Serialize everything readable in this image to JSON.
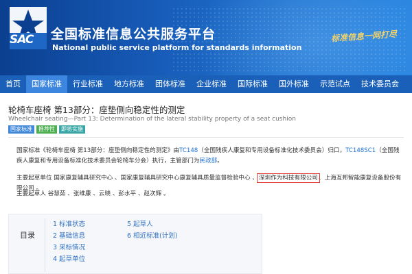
{
  "header": {
    "logo_text": "SAC",
    "title": "全国标准信息公共服务平台",
    "subtitle": "National public service platform  for standards information",
    "slogan": "标准信息一网打尽",
    "colors": {
      "banner": "#1659b5",
      "nav": "#1a5fb8",
      "nav_active": "#3c86e0",
      "slogan": "#f3d36b"
    }
  },
  "nav": {
    "items": [
      "首页",
      "国家标准",
      "行业标准",
      "地方标准",
      "团体标准",
      "企业标准",
      "国际标准",
      "国外标准",
      "示范试点",
      "技术委员会"
    ],
    "active_index": 1
  },
  "standard": {
    "title": "轮椅车座椅 第13部分：座垫侧向稳定性的测定",
    "title_en": "Wheelchair seating—Part 13: Determination of the lateral stability property of a seat cushion",
    "badges": [
      "国家标准",
      "推荐性",
      "即将实施"
    ]
  },
  "paragraphs": {
    "p1_prefix": "国家标准《轮椅车座椅 第13部分：座垫侧向稳定性的测定》由",
    "p1_link1": "TC148",
    "p1_mid": "（全国残疾人康复和专用设备标准化技术委员会）归口，",
    "p1_link2": "TC148SC1",
    "p1_mid2": "（全国残疾人康复和专用设备标准化技术委员会轮椅车分会）执行，主管部门为",
    "p1_link3": "民政部",
    "p1_end": "。",
    "p2_prefix": "主要起草单位 国家康复辅具研究中心 、国家康复辅具研究中心康复辅具质量监督检验中心 、",
    "p2_highlight": "深圳作为科技有限公司",
    "p2_suffix": "、上海互邦智能康复设备股份有限公司 。",
    "p3": "主要起草人 谷慧茹 、张维康 、云晓 、彭水平 、赵次辉 。"
  },
  "toc": {
    "label": "目录",
    "col1": [
      "1 标准状态",
      "2 基础信息",
      "3 采标情况",
      "4 起草单位"
    ],
    "col2": [
      "5 起草人",
      "6 相近标准(计划)"
    ]
  }
}
